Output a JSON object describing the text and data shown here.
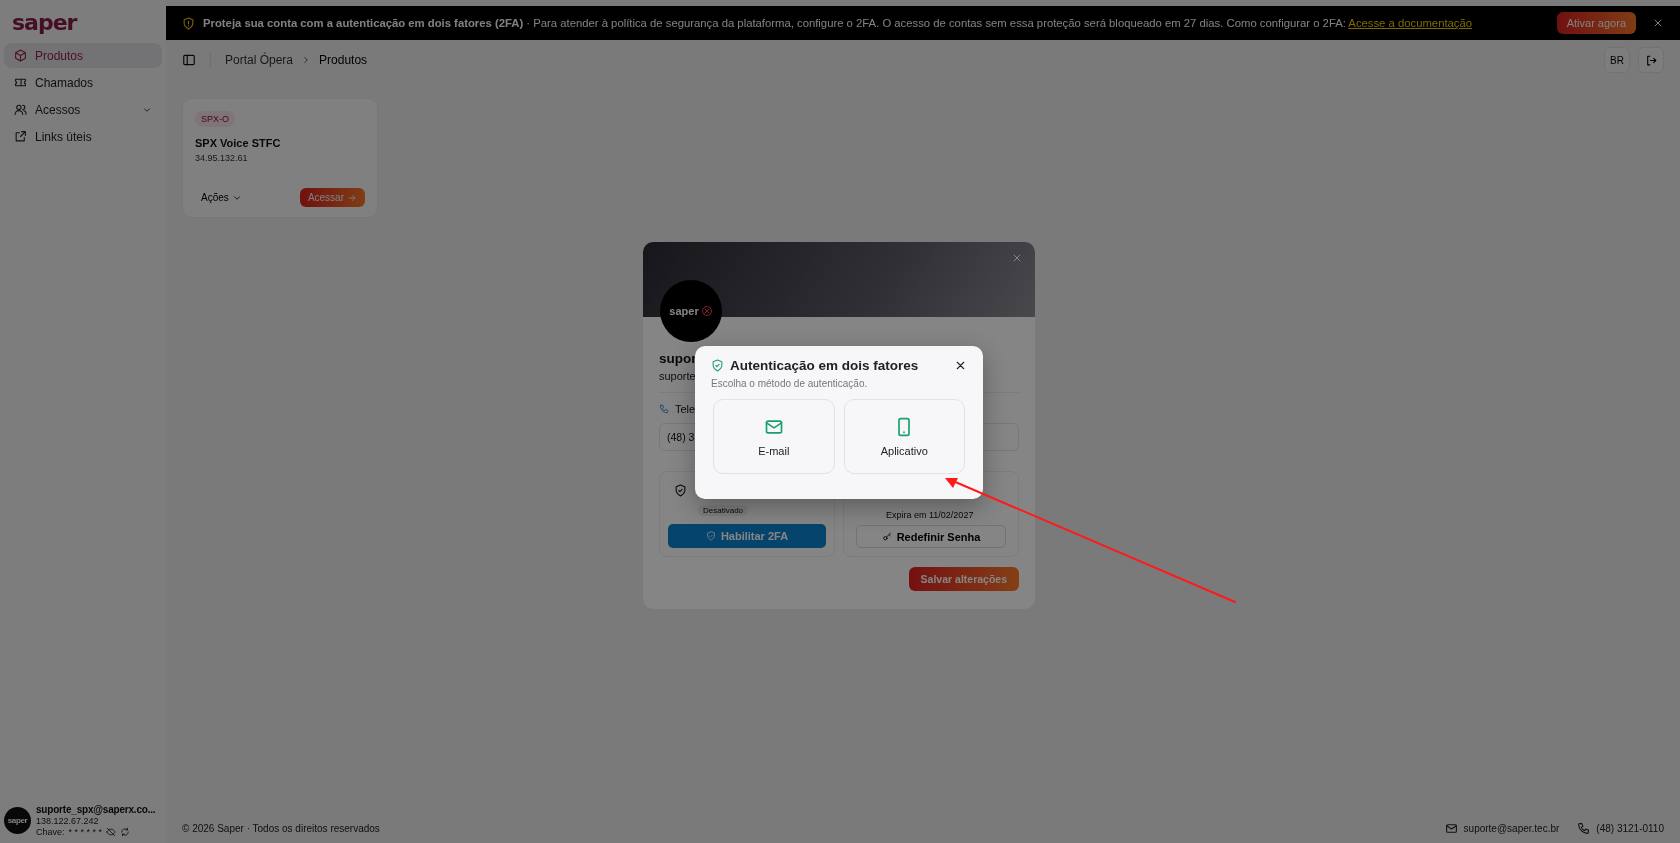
{
  "sidebar": {
    "logo": "saper",
    "items": [
      {
        "label": "Produtos",
        "kind": "box",
        "selected": true,
        "has_submenu": false
      },
      {
        "label": "Chamados",
        "kind": "ticket",
        "selected": false,
        "has_submenu": false
      },
      {
        "label": "Acessos",
        "kind": "users",
        "selected": false,
        "has_submenu": true
      },
      {
        "label": "Links úteis",
        "kind": "link",
        "selected": false,
        "has_submenu": false
      }
    ],
    "user": {
      "avatar_text": "saper",
      "email": "suporte_spx@saperx.co...",
      "ip": "138.122.67.242",
      "key_label": "Chave:",
      "key_value": "* * * * * *"
    }
  },
  "banner": {
    "title": "Proteja sua conta com a autenticação em dois fatores (2FA)",
    "separator": "·",
    "message": "Para atender à política de segurança da plataforma, configure o 2FA. O acesso de contas sem essa proteção será bloqueado em 27 dias. Como configurar o 2FA:",
    "link": "Acesse a documentação",
    "button": "Ativar agora"
  },
  "breadcrumb": [
    "Portal Ópera",
    "Produtos"
  ],
  "language": "BR",
  "products": [
    {
      "tag": "SPX-O",
      "name": "SPX Voice STFC",
      "ip": "34.95.132.61",
      "actions": "Ações",
      "access": "Acessar"
    }
  ],
  "footer": {
    "copyright": "© 2026 Saper · Todos os direitos reservados",
    "email": "suporte@saper.tec.br",
    "phone": "(48) 3121-0110"
  },
  "profile_modal": {
    "avatar_text": "saper",
    "name": "supor",
    "email": "suporte",
    "phone_label": "Tele",
    "phone_value": "(48) 3",
    "twofa_status": "Desativado",
    "enable_button": "Habilitar 2FA",
    "expiry": "Expira em 11/02/2027",
    "reset_button": "Redefinir Senha",
    "save_button": "Salvar alterações"
  },
  "dialog": {
    "title": "Autenticação em dois fatores",
    "subtitle": "Escolha o método de autenticação.",
    "options": [
      {
        "kind": "email",
        "label": "E-mail"
      },
      {
        "kind": "app",
        "label": "Aplicativo"
      }
    ]
  }
}
